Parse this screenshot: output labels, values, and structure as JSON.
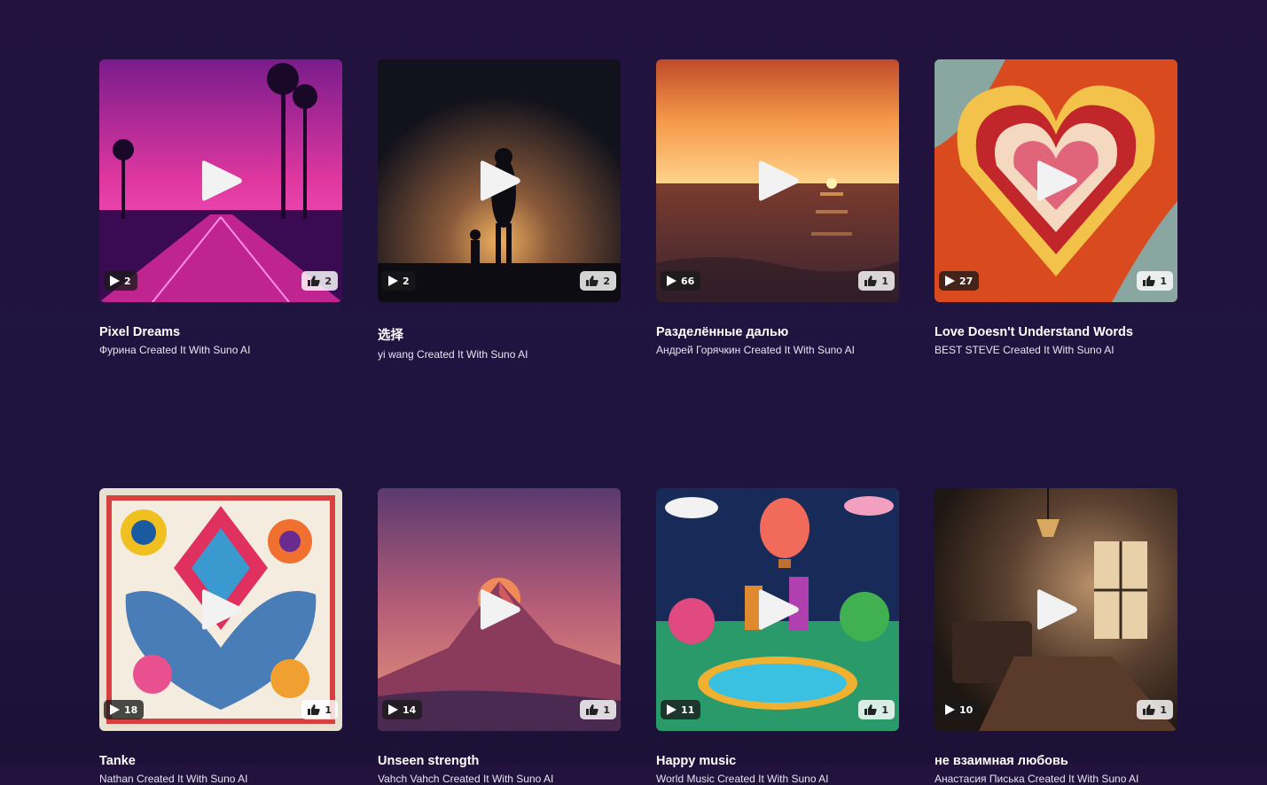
{
  "tracks": [
    {
      "title": "Pixel Dreams",
      "subtitle": "Фурина Created It With Suno AI",
      "plays": "2",
      "likes": "2"
    },
    {
      "title": "选择",
      "subtitle": "yi wang Created It With Suno AI",
      "plays": "2",
      "likes": "2"
    },
    {
      "title": "Разделённые далью",
      "subtitle": "Андрей Горячкин Created It With Suno AI",
      "plays": "66",
      "likes": "1"
    },
    {
      "title": "Love Doesn't Understand Words",
      "subtitle": "BEST STEVE Created It With Suno AI",
      "plays": "27",
      "likes": "1"
    },
    {
      "title": "Tanke",
      "subtitle": "Nathan Created It With Suno AI",
      "plays": "18",
      "likes": "1"
    },
    {
      "title": "Unseen strength",
      "subtitle": "Vahch Vahch Created It With Suno AI",
      "plays": "14",
      "likes": "1"
    },
    {
      "title": "Happy music",
      "subtitle": "World Music Created It With Suno AI",
      "plays": "11",
      "likes": "1"
    },
    {
      "title": "не взаимная любовь",
      "subtitle": "Анастасия Писька Created It With Suno AI",
      "plays": "10",
      "likes": "1"
    }
  ],
  "icons": {
    "play": "play-icon",
    "like": "thumbs-up-icon"
  },
  "colors": {
    "background": "#21133e",
    "text": "#ffffff"
  }
}
